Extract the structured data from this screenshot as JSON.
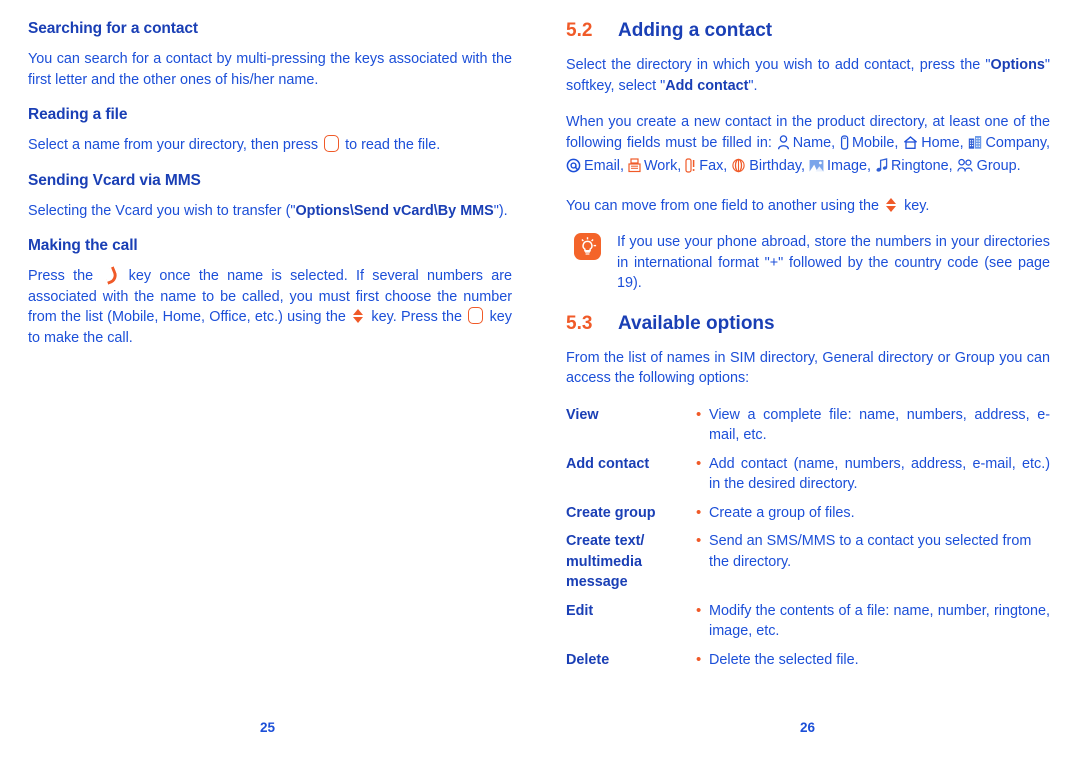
{
  "document": {
    "left_page_number": "25",
    "right_page_number": "26",
    "colors": {
      "heading_blue": "#1a3fb5",
      "body_blue": "#1c4fd8",
      "accent_orange": "#f05a28",
      "tip_orange": "#f4642a",
      "background": "#ffffff"
    }
  },
  "left_column": {
    "searching": {
      "heading": "Searching for a contact",
      "body": "You can search for a contact by multi-pressing the keys associated with the first letter and the other ones of his/her name."
    },
    "reading": {
      "heading": "Reading a file",
      "body_before": "Select a name from your directory, then press",
      "body_after": "to read the file."
    },
    "vcard": {
      "heading": "Sending Vcard via MMS",
      "body_before": "Selecting the Vcard you wish to transfer (\"",
      "body_bold": "Options\\Send vCard\\By MMS",
      "body_after": "\")."
    },
    "calling": {
      "heading": "Making the call",
      "part1": "Press the",
      "part2": "key once the name is selected. If several numbers are associated with the name to be called, you must first choose the number from the list (Mobile, Home, Office, etc.) using the",
      "part3": "key. Press the",
      "part4": "key to make the call."
    }
  },
  "right_column": {
    "section_52": {
      "number": "5.2",
      "title": "Adding a contact",
      "para1_a": "Select the directory in which you wish to add contact, press the \"",
      "para1_b": "Options",
      "para1_c": "\" softkey, select \"",
      "para1_d": "Add contact",
      "para1_e": "\".",
      "para2_intro": "When you create a new contact in the product directory, at least one of the following fields must be filled in:",
      "fields": [
        {
          "icon": "person-icon",
          "label": "Name,"
        },
        {
          "icon": "mobile-phone-icon",
          "label": "Mobile,"
        },
        {
          "icon": "home-icon",
          "label": "Home,"
        },
        {
          "icon": "company-building-icon",
          "label": "Company,"
        },
        {
          "icon": "email-at-icon",
          "label": "Email,"
        },
        {
          "icon": "work-fax-machine-icon",
          "label": "Work,"
        },
        {
          "icon": "fax-icon",
          "label": "Fax,"
        },
        {
          "icon": "birthday-icon",
          "label": "Birthday,"
        },
        {
          "icon": "image-icon",
          "label": "Image,"
        },
        {
          "icon": "ringtone-note-icon",
          "label": "Ringtone,"
        },
        {
          "icon": "group-people-icon",
          "label": "Group."
        }
      ],
      "para3_before": "You can move from one field to another using the",
      "para3_after": "key.",
      "tip": "If you use your phone abroad, store the numbers in your directories in international format \"+\" followed by the country code (see page 19)."
    },
    "section_53": {
      "number": "5.3",
      "title": "Available options",
      "intro": "From the list of names in SIM directory, General directory or Group you can access the following options:",
      "bullet": "•",
      "options": [
        {
          "name": "View",
          "desc": "View a complete file: name, numbers, address, e-mail, etc."
        },
        {
          "name": "Add contact",
          "desc": "Add contact (name, numbers, address, e-mail, etc.) in the desired directory."
        },
        {
          "name": "Create group",
          "desc": "Create a group of files."
        },
        {
          "name": "Create text/ multimedia message",
          "desc": "Send an SMS/MMS to a contact you selected from the directory."
        },
        {
          "name": "Edit",
          "desc": "Modify the contents of a file: name, number, ringtone, image, etc."
        },
        {
          "name": "Delete",
          "desc": "Delete the selected file."
        }
      ]
    }
  }
}
